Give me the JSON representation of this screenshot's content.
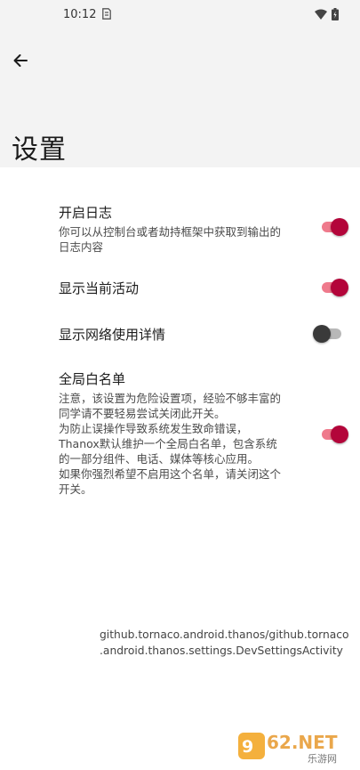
{
  "status_bar": {
    "time": "10:12",
    "icons": [
      "sim-icon",
      "wifi-icon",
      "battery-icon"
    ]
  },
  "app_bar": {
    "back_icon": "arrow-back-icon",
    "title": "设置"
  },
  "preferences": [
    {
      "title": "开启日志",
      "summary": "你可以从控制台或者劫持框架中获取到输出的\n日志内容",
      "enabled": true
    },
    {
      "title": "显示当前活动",
      "summary": "",
      "enabled": true
    },
    {
      "title": "显示网络使用详情",
      "summary": "",
      "enabled": false
    },
    {
      "title": "全局白名单",
      "summary": "注意，该设置为危险设置项，经验不够丰富的\n同学请不要轻易尝试关闭此开关。\n为防止误操作导致系统发生致命错误，\nThanox默认维护一个全局白名单，包含系统\n的一部分组件、电话、媒体等核心应用。\n如果你强烈希望不启用这个名单，请关闭这个\n开关。",
      "enabled": true
    }
  ],
  "activity_name": "github.tornaco.android.thanos/github.tornaco\n.android.thanos.settings.DevSettingsActivity",
  "watermark": {
    "logo_text": "962.NET",
    "sub_text": "乐游网"
  },
  "colors": {
    "accent": "#b3053a",
    "accent_track": "#ef7a8c",
    "header_bg": "#f3f3f3"
  }
}
